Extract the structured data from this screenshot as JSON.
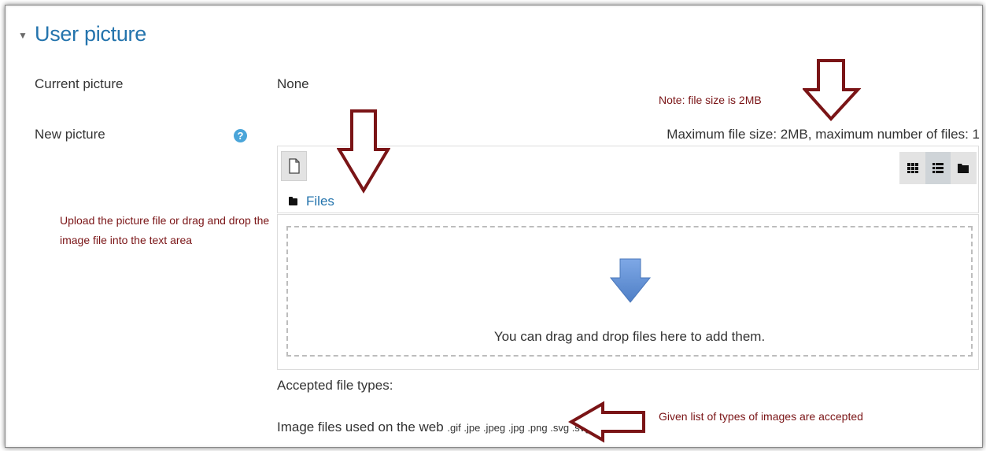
{
  "section": {
    "toggle_glyph": "▼",
    "title": "User picture"
  },
  "fields": {
    "current_picture_label": "Current picture",
    "current_picture_value": "None",
    "new_picture_label": "New picture",
    "help_glyph": "?"
  },
  "filepicker": {
    "max_size_text": "Maximum file size: 2MB, maximum number of files: 1",
    "add_icon": "file-icon",
    "view_buttons": [
      {
        "icon": "grid-icon",
        "active": false
      },
      {
        "icon": "list-icon",
        "active": true
      },
      {
        "icon": "folder-icon",
        "active": false
      }
    ],
    "files_link": "Files",
    "drop_text": "You can drag and drop files here to add them.",
    "drop_icon": "down-arrow-icon"
  },
  "accepted": {
    "title": "Accepted file types:",
    "type_name": "Image files used on the web",
    "extensions": ".gif .jpe .jpeg .jpg .png .svg .svgz"
  },
  "annotations": {
    "note_file_size": "Note: file size is 2MB",
    "upload_hint_line1": "Upload the picture file or drag and drop the",
    "upload_hint_line2": "image file into the text area",
    "accepted_types_note": "Given list of types of images are accepted",
    "arrow_color": "#7a1416"
  },
  "colors": {
    "link": "#2474ad",
    "help_icon": "#4aa5d9",
    "drop_arrow": "#5b8fd6"
  }
}
